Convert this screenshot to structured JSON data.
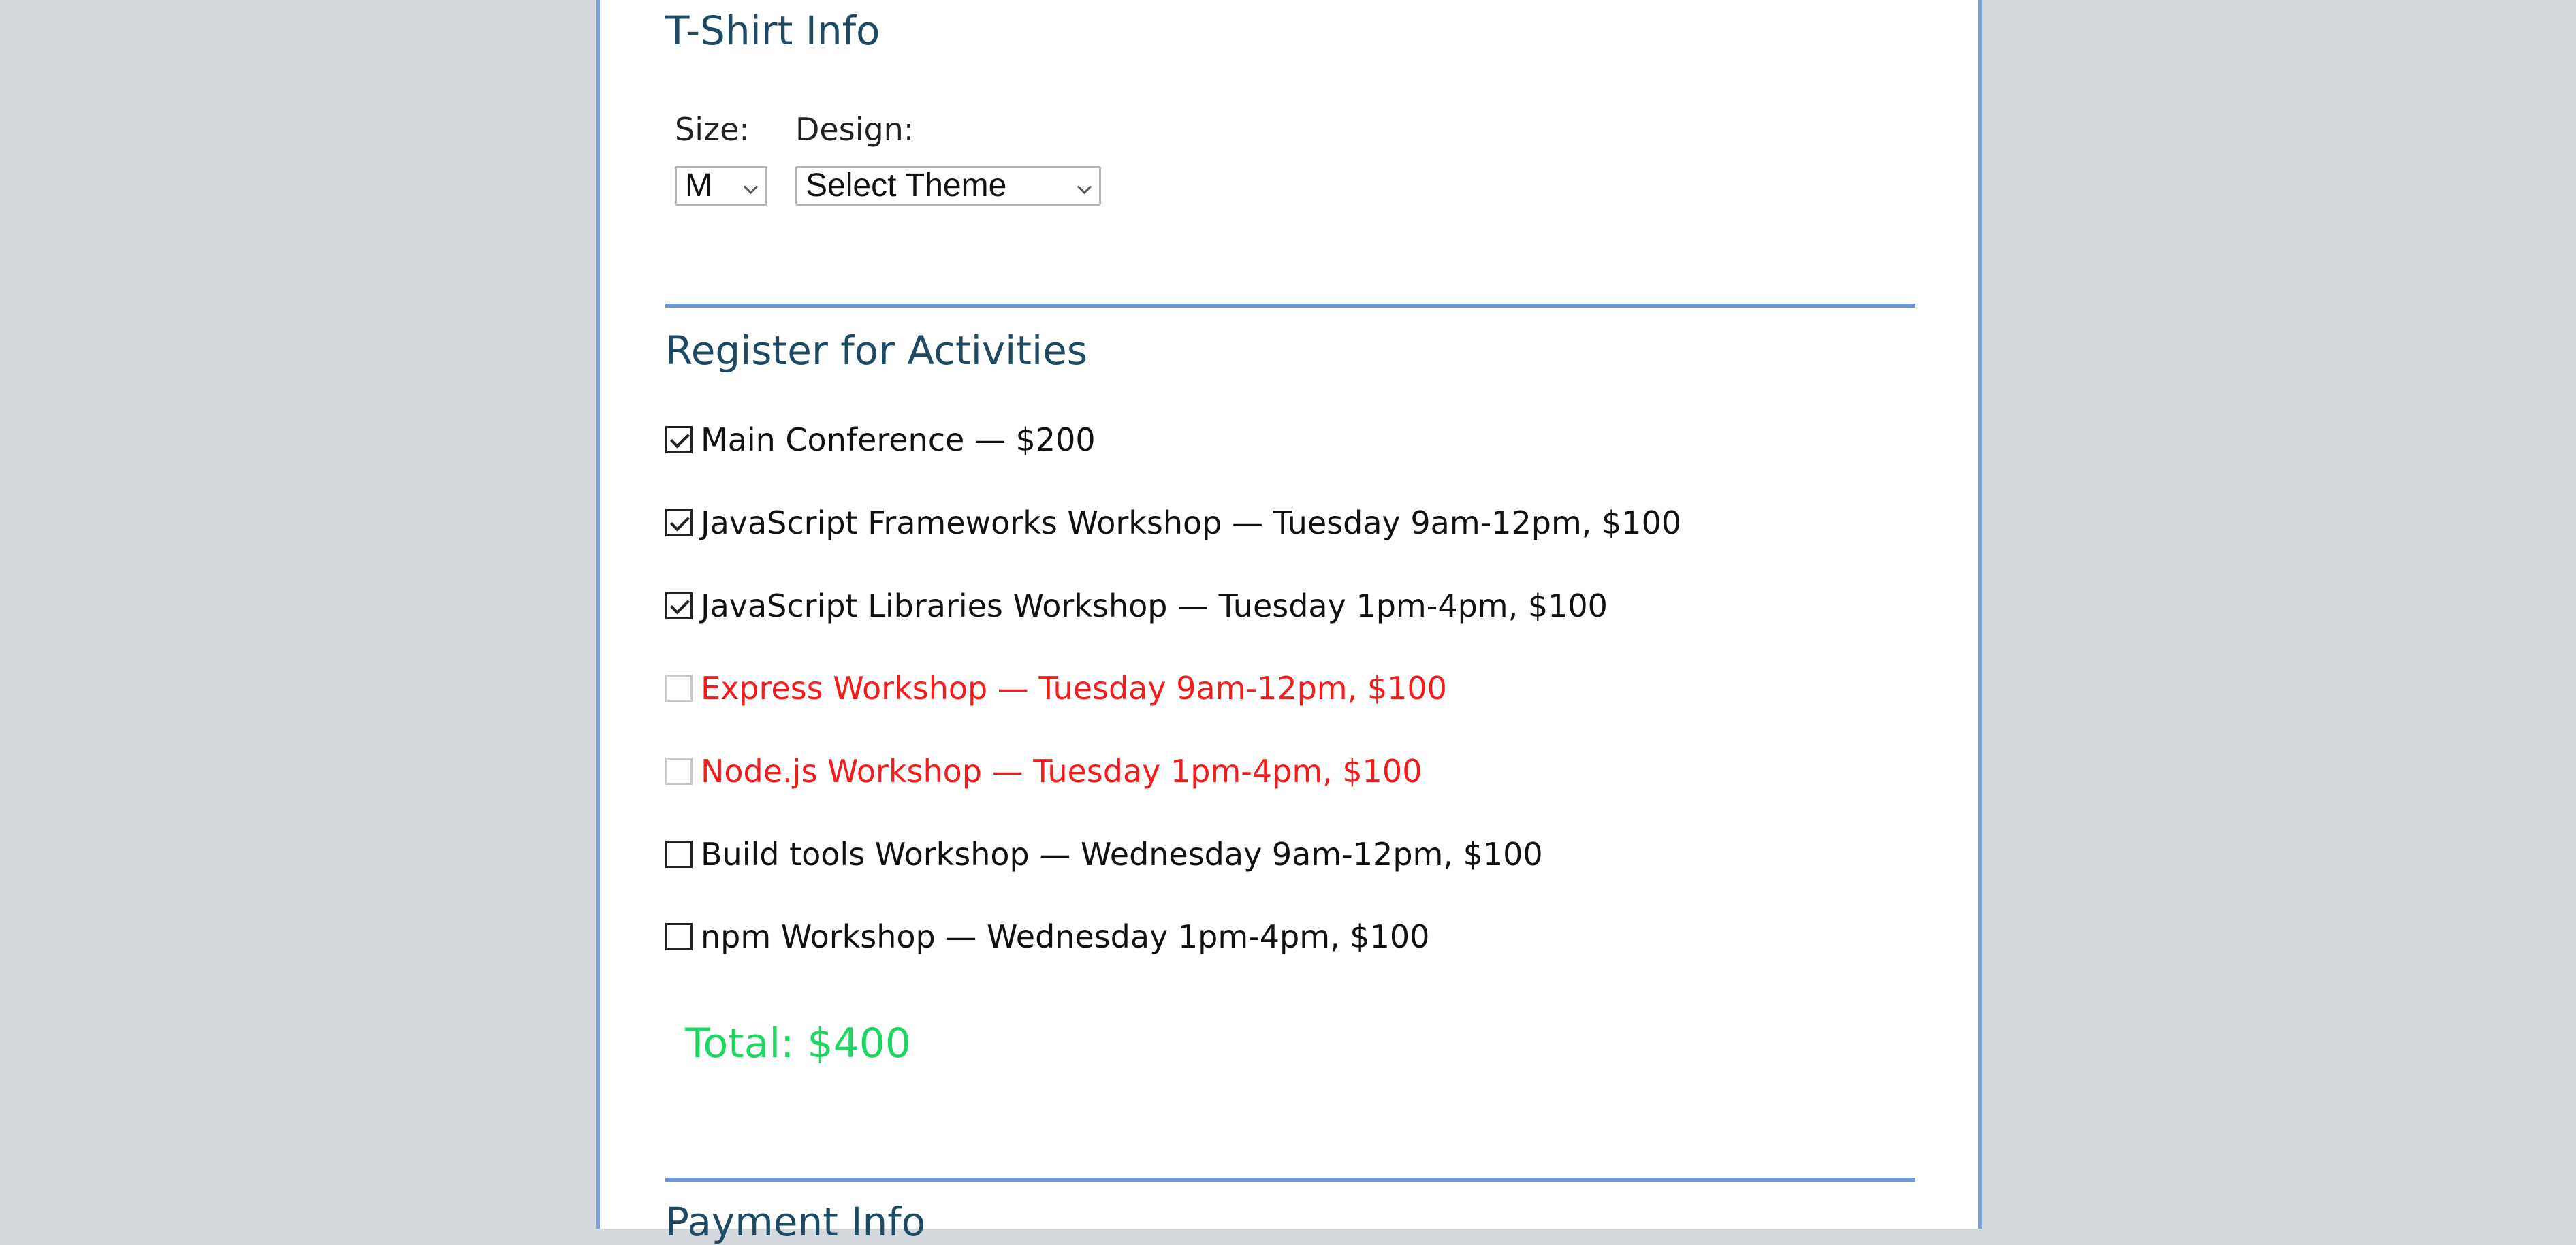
{
  "tshirt": {
    "heading": "T-Shirt Info",
    "size_label": "Size:",
    "size_value": "M",
    "design_label": "Design:",
    "design_value": "Select Theme"
  },
  "activities": {
    "heading": "Register for Activities",
    "items": [
      {
        "label": "Main Conference — $200",
        "checked": true,
        "disabled": false
      },
      {
        "label": "JavaScript Frameworks Workshop — Tuesday 9am-12pm, $100",
        "checked": true,
        "disabled": false
      },
      {
        "label": "JavaScript Libraries Workshop — Tuesday 1pm-4pm, $100",
        "checked": true,
        "disabled": false
      },
      {
        "label": "Express Workshop — Tuesday 9am-12pm, $100",
        "checked": false,
        "disabled": true
      },
      {
        "label": "Node.js Workshop — Tuesday 1pm-4pm, $100",
        "checked": false,
        "disabled": true
      },
      {
        "label": "Build tools Workshop — Wednesday 9am-12pm, $100",
        "checked": false,
        "disabled": false
      },
      {
        "label": "npm Workshop — Wednesday 1pm-4pm, $100",
        "checked": false,
        "disabled": false
      }
    ],
    "total": "Total: $400"
  },
  "payment": {
    "heading": "Payment Info"
  },
  "colors": {
    "heading": "#1e4a63",
    "rule": "#6d98d8",
    "conflict": "#f51b1b",
    "total": "#1ed760",
    "background": "#d5d8dd"
  }
}
